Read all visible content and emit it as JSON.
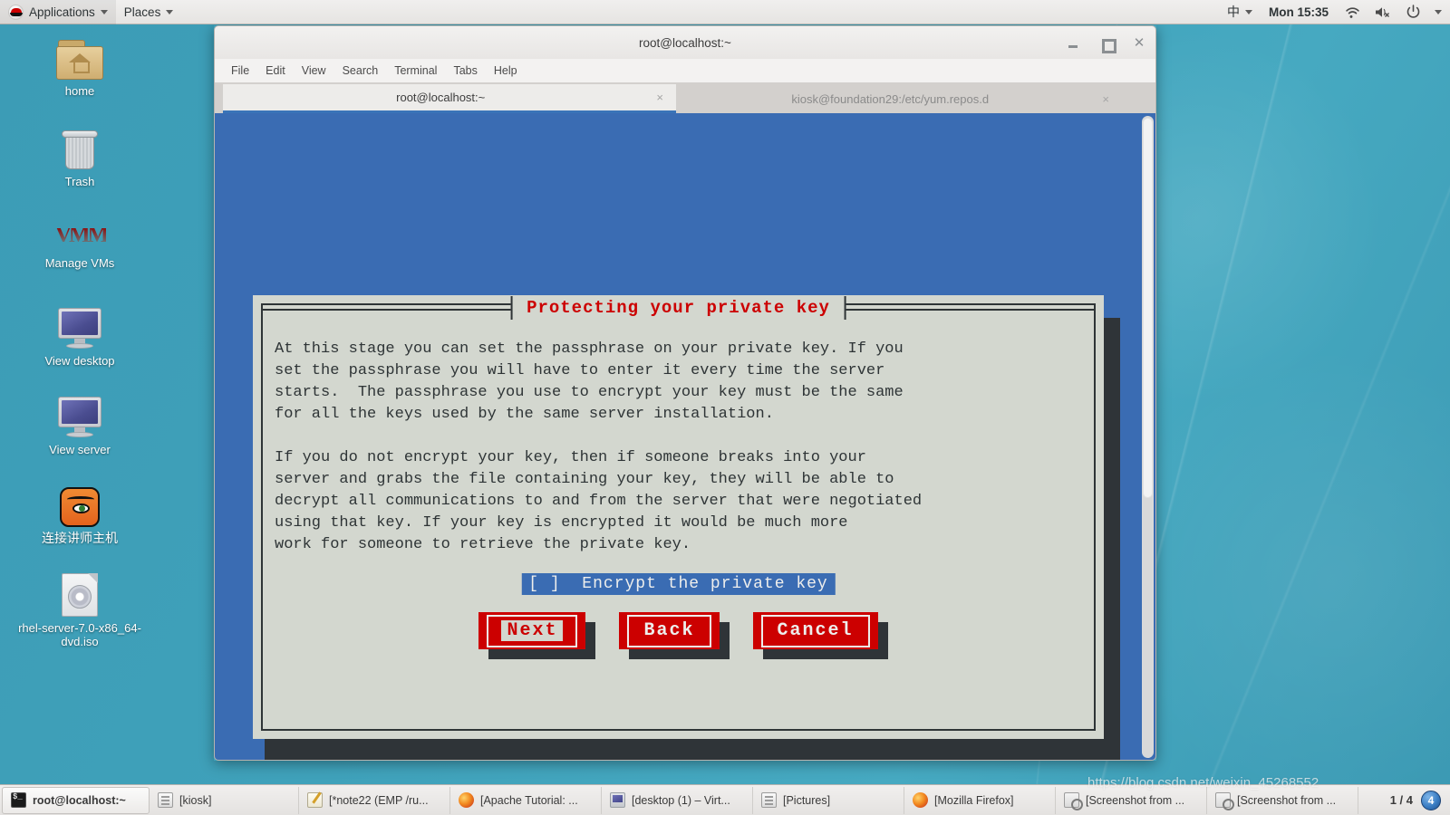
{
  "top_panel": {
    "logo_icon": "redhat-logo-icon",
    "applications_label": "Applications",
    "places_label": "Places",
    "input_method": "中",
    "clock": "Mon 15:35",
    "wifi_icon": "wifi-icon",
    "volume_icon": "volume-muted-icon",
    "power_icon": "power-icon"
  },
  "desktop_icons": [
    {
      "label": "home",
      "icon": "home-folder-icon"
    },
    {
      "label": "Trash",
      "icon": "trash-icon"
    },
    {
      "label": "Manage VMs",
      "icon": "vmm-icon"
    },
    {
      "label": "View desktop",
      "icon": "monitor-icon"
    },
    {
      "label": "View server",
      "icon": "monitor-icon"
    },
    {
      "label": "连接讲师主机",
      "icon": "vnc-fox-icon"
    },
    {
      "label": "rhel-server-7.0-x86_64-dvd.iso",
      "icon": "iso-disc-icon"
    }
  ],
  "terminal": {
    "title": "root@localhost:~",
    "window_buttons": {
      "minimize": "–",
      "maximize": "□",
      "close": "✕"
    },
    "menu": [
      "File",
      "Edit",
      "View",
      "Search",
      "Terminal",
      "Tabs",
      "Help"
    ],
    "tabs": [
      {
        "title": "root@localhost:~",
        "close": "×",
        "active": true
      },
      {
        "title": "kiosk@foundation29:/etc/yum.repos.d",
        "close": "×",
        "active": false
      }
    ],
    "background_color": "#3a6cb3"
  },
  "dialog": {
    "title": "Protecting your private key",
    "title_color": "#cc0000",
    "background_color": "#d3d7cf",
    "body_text": "At this stage you can set the passphrase on your private key. If you\nset the passphrase you will have to enter it every time the server\nstarts.  The passphrase you use to encrypt your key must be the same\nfor all the keys used by the same server installation.\n\nIf you do not encrypt your key, then if someone breaks into your\nserver and grabs the file containing your key, they will be able to\ndecrypt all communications to and from the server that were negotiated\nusing that key. If your key is encrypted it would be much more\nwork for someone to retrieve the private key.",
    "checkbox": {
      "marker": "[ ]",
      "label": "Encrypt the private key",
      "checked": false,
      "highlight_color": "#3a6cb3"
    },
    "buttons": [
      {
        "label": "Next",
        "focused": true
      },
      {
        "label": "Back",
        "focused": false
      },
      {
        "label": "Cancel",
        "focused": false
      }
    ],
    "button_color": "#cc0000"
  },
  "taskbar": {
    "items": [
      {
        "label": "root@localhost:~",
        "icon": "terminal-icon",
        "active": true
      },
      {
        "label": "[kiosk]",
        "icon": "file-manager-icon",
        "active": false
      },
      {
        "label": "[*note22 (EMP /ru...",
        "icon": "text-editor-icon",
        "active": false
      },
      {
        "label": "[Apache Tutorial: ...",
        "icon": "firefox-icon",
        "active": false
      },
      {
        "label": "[desktop (1) – Virt...",
        "icon": "monitor-icon",
        "active": false
      },
      {
        "label": "[Pictures]",
        "icon": "file-manager-icon",
        "active": false
      },
      {
        "label": "[Mozilla Firefox]",
        "icon": "firefox-icon",
        "active": false
      },
      {
        "label": "[Screenshot from ...",
        "icon": "screenshot-icon",
        "active": false
      },
      {
        "label": "[Screenshot from ...",
        "icon": "screenshot-icon",
        "active": false
      }
    ],
    "workspace": "1 / 4",
    "workspace_icon_glyph": "4"
  },
  "watermark": "https://blog.csdn.net/weixin_45268552"
}
